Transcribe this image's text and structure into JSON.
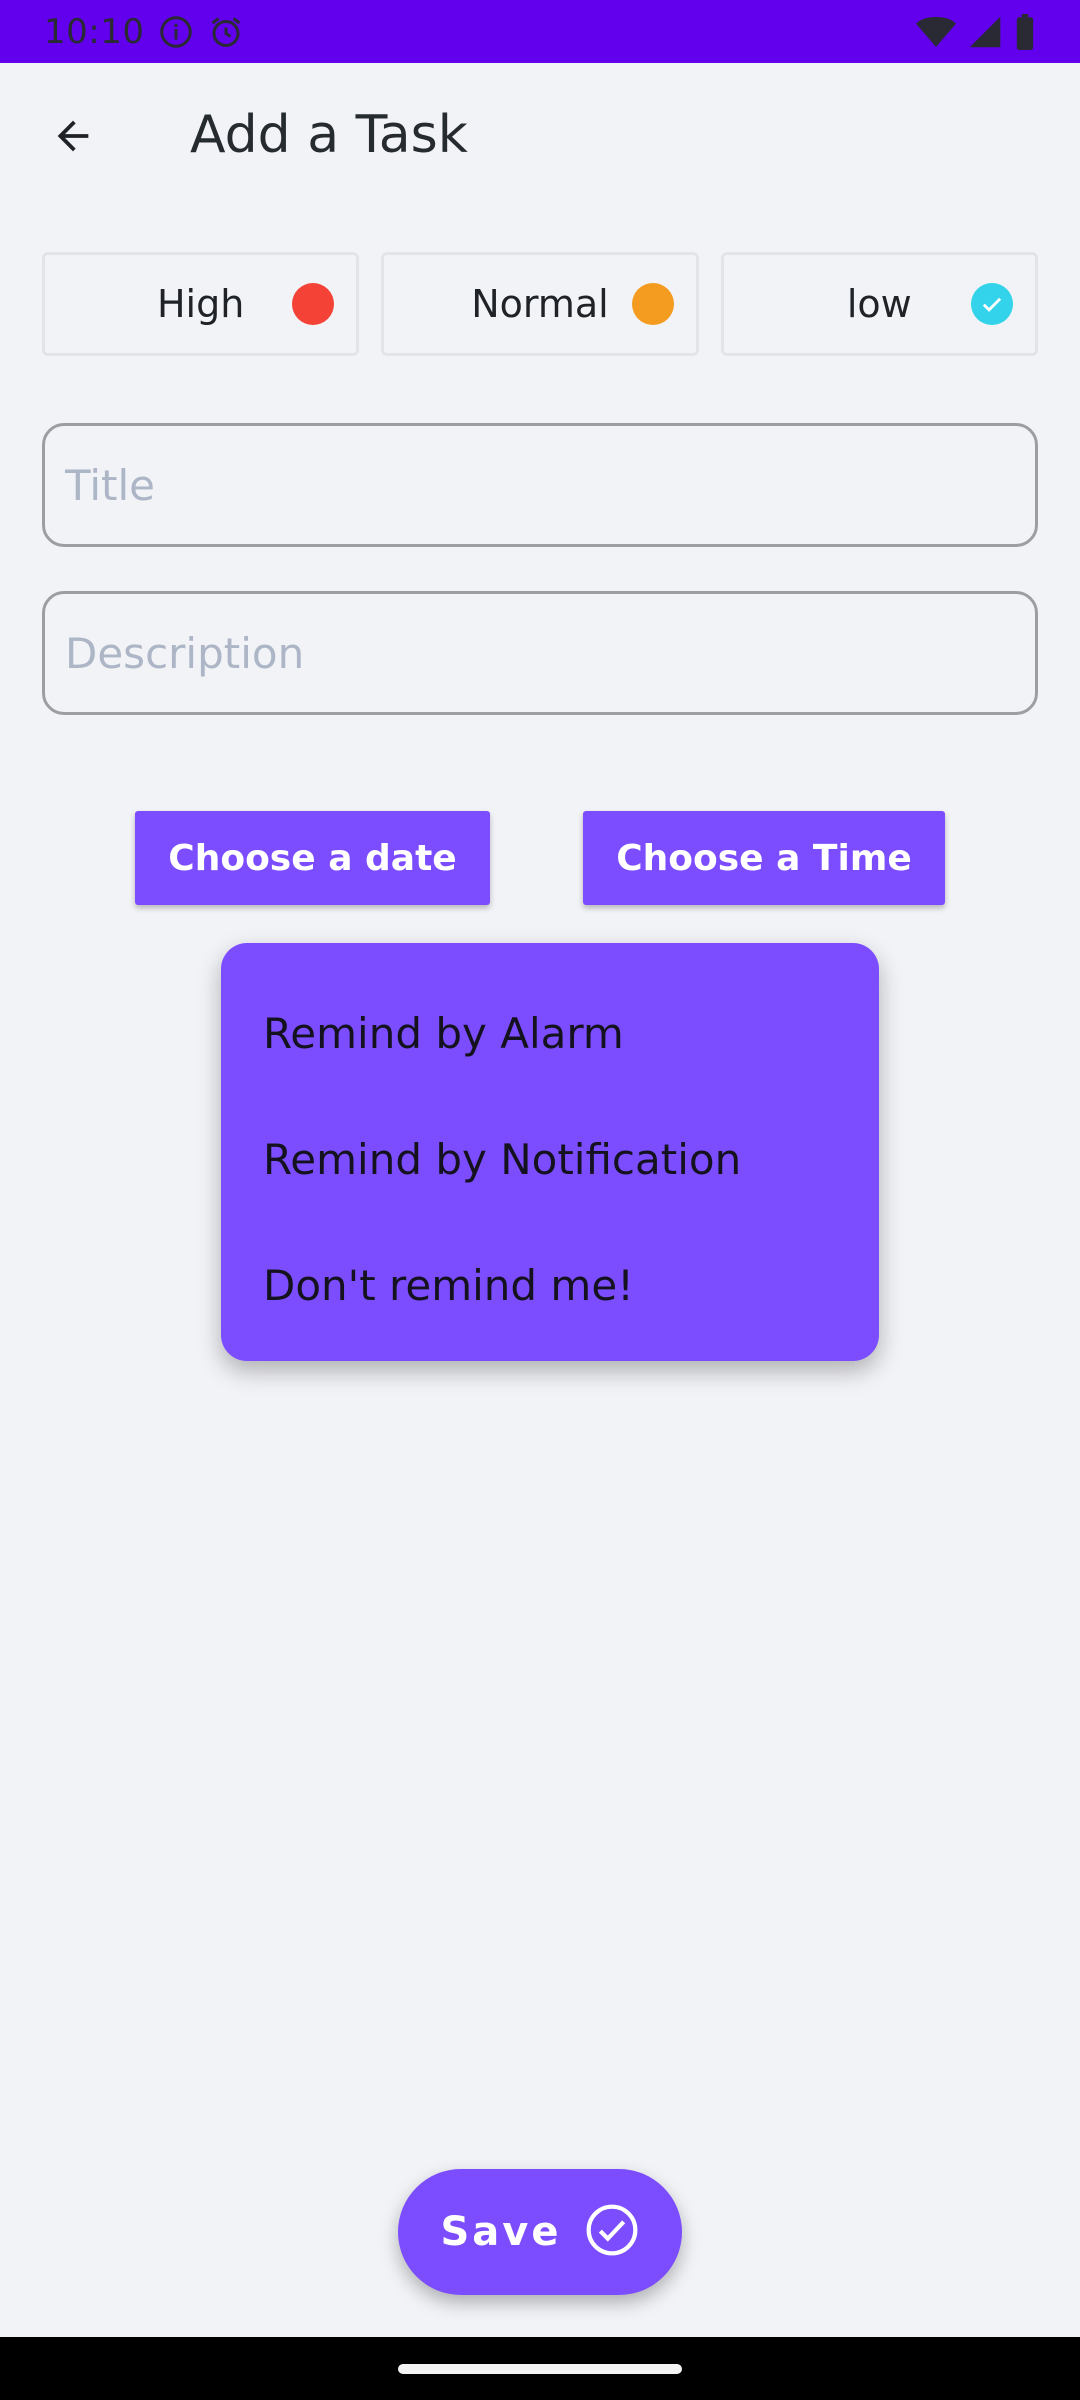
{
  "status_bar": {
    "time": "10:10",
    "icons_left": [
      "info-icon",
      "alarm-icon"
    ],
    "icons_right": [
      "wifi-icon",
      "signal-icon",
      "battery-icon"
    ]
  },
  "app_bar": {
    "title": "Add a Task",
    "back_icon": "arrow-back-icon"
  },
  "priorities": [
    {
      "label": "High",
      "color": "#f44336",
      "selected": false
    },
    {
      "label": "Normal",
      "color": "#f39c1f",
      "selected": false
    },
    {
      "label": "low",
      "color": "#33d3ec",
      "selected": true
    }
  ],
  "form": {
    "title_placeholder": "Title",
    "title_value": "",
    "description_placeholder": "Description",
    "description_value": ""
  },
  "buttons": {
    "choose_date": "Choose a date",
    "choose_time": "Choose a Time"
  },
  "reminder_menu": {
    "items": [
      "Remind by Alarm",
      "Remind by Notification",
      "Don't remind me!"
    ]
  },
  "save": {
    "label": "Save",
    "icon": "check-circle-icon"
  },
  "colors": {
    "status_bar": "#6200ee",
    "accent": "#7c4dff",
    "background": "#f2f3f7"
  }
}
